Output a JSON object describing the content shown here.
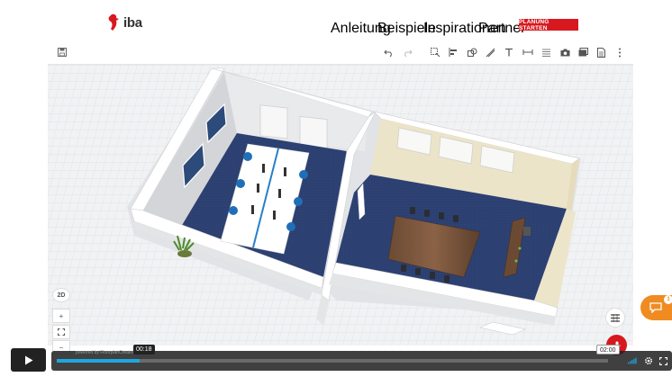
{
  "brand": {
    "name": "iba",
    "color": "#d7191f"
  },
  "nav": {
    "links": [
      "Anleitung",
      "Beispiele",
      "Inspirationen",
      "Partner"
    ],
    "cta": "PLANUNG STARTEN"
  },
  "toolbar": {
    "left": [
      "save-icon"
    ],
    "right": [
      "undo-icon",
      "redo-icon",
      "select-icon",
      "align-icon",
      "shapes-icon",
      "measure-line-icon",
      "text-icon",
      "dimension-icon",
      "texture-icon",
      "camera-icon",
      "gallery-icon",
      "document-icon",
      "more-icon"
    ]
  },
  "view_controls": {
    "mode_label": "2D",
    "zoom_in": "+",
    "zoom_out": "−"
  },
  "chat": {
    "badge_count": "1"
  },
  "player": {
    "current_time": "00:18",
    "total_time": "02:00",
    "progress": 0.15,
    "powered_by": "powered by FloorplanCreator"
  },
  "colors": {
    "accent_red": "#d7191f",
    "chat_orange": "#f08b22",
    "progress_blue": "#1fa7e0",
    "carpet_blue": "#2a3d6b",
    "wall_cream": "#ece4c8"
  }
}
